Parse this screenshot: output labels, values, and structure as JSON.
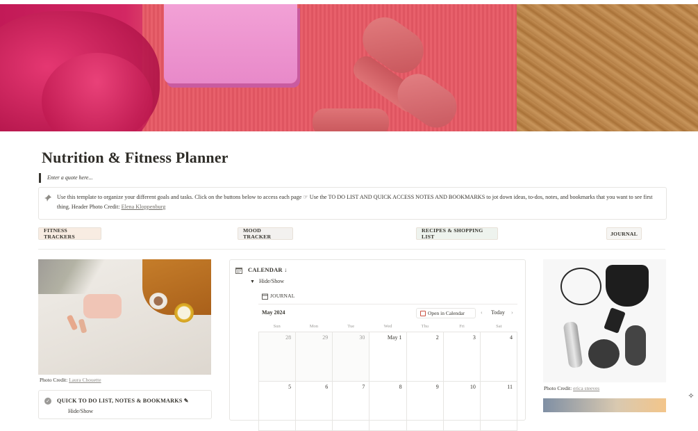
{
  "page": {
    "title": "Nutrition & Fitness Planner",
    "quote": "Enter a quote here..."
  },
  "cover": {
    "description_icon": "cover-image"
  },
  "callout": {
    "icon": "pin-icon",
    "text": "Use this template to organize your different goals and tasks. Click on the buttons below to access each page ☞ Use the TO DO LIST AND QUICK ACCESS NOTES AND BOOKMARKS to jot down ideas, to-dos, notes, and bookmarks that you want to see first thing. Header Photo Credit: ",
    "link": "Elena Kloppenburg"
  },
  "buttons": {
    "fitness": "FITNESS TRACKERS",
    "mood": "MOOD TRACKER",
    "recipes": "RECIPES & SHOPPING LIST",
    "journal": "JOURNAL"
  },
  "left": {
    "credit_prefix": "Photo Credit: ",
    "credit_link": "Laura Chouette",
    "todo_title": "QUICK TO DO LIST, NOTES & BOOKMARKS ✎",
    "todo_toggle": "Hide/Show"
  },
  "calendar": {
    "title": "CALENDAR ↓",
    "toggle": "Hide/Show",
    "view_label": "JOURNAL",
    "month": "May 2024",
    "open_label": "Open in Calendar",
    "today_label": "Today",
    "weekdays": [
      "Sun",
      "Mon",
      "Tue",
      "Wed",
      "Thu",
      "Fri",
      "Sat"
    ],
    "weeks": [
      [
        "28",
        "29",
        "30",
        "May 1",
        "2",
        "3",
        "4"
      ],
      [
        "5",
        "6",
        "7",
        "8",
        "9",
        "10",
        "11"
      ]
    ]
  },
  "right": {
    "credit_prefix": "Photo Credit: ",
    "credit_link": "erica steeves"
  },
  "colors": {
    "text": "#37352f",
    "muted": "#9b9a97",
    "border": "#e6e5e2",
    "fitness_btn": "#f8ece2",
    "recipes_btn": "#eef3ee"
  }
}
